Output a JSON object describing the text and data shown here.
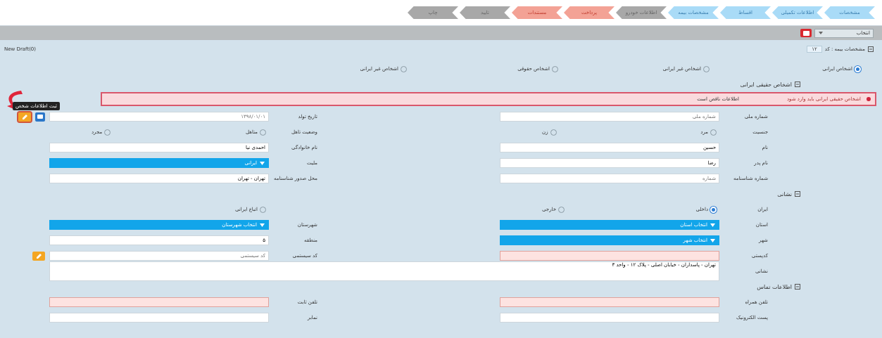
{
  "steps": [
    {
      "label": "مشخصات",
      "kind": "info"
    },
    {
      "label": "اطلاعات تکمیلی",
      "kind": "info"
    },
    {
      "label": "اقساط",
      "kind": "info"
    },
    {
      "label": "مشخصات بیمه",
      "kind": "info"
    },
    {
      "label": "اطلاعات خودرو",
      "kind": "pending"
    },
    {
      "label": "پرداخت",
      "kind": "error"
    },
    {
      "label": "مستندات",
      "kind": "error"
    },
    {
      "label": "تایید",
      "kind": "pending"
    },
    {
      "label": "چاپ",
      "kind": "pending"
    }
  ],
  "toolbar": {
    "select": {
      "value": "انتخاب"
    }
  },
  "header": {
    "title": "مشخصات بیمه : کد",
    "code": "۱۲",
    "draft": "New Draft(0)"
  },
  "person_types": [
    {
      "label": "اشخاص ایرانی",
      "selected": true
    },
    {
      "label": "اشخاص غیر ایرانی",
      "selected": false
    },
    {
      "label": "اشخاص حقوقی",
      "selected": false
    },
    {
      "label": "اشخاص غیر ایرانی",
      "selected": false
    }
  ],
  "sections": [
    {
      "title": "اشخاص حقیقی ایرانی",
      "error": {
        "title": "اشخاص حقیقی ایرانی باید وارد شود",
        "detail": "اطلاعات ناقص است"
      },
      "rows": [
        {
          "fields": [
            {
              "kind": "text",
              "label": "شماره ملی",
              "placeholder": "شماره ملی"
            },
            {
              "kind": "text",
              "label": "تاریخ تولد",
              "placeholder": "۱۳۹۸/۰۱/۰۱",
              "buttons": [
                {
                  "kind": "primary"
                },
                {
                  "kind": "warning",
                  "tooltip": "ثبت اطلاعات شخص"
                }
              ]
            }
          ]
        },
        {
          "fields": [
            {
              "kind": "radio",
              "label": "جنسیت",
              "options": [
                {
                  "label": "مرد",
                  "selected": false
                },
                {
                  "label": "زن",
                  "selected": false
                }
              ]
            },
            {
              "kind": "radio",
              "label": "وضعیت تاهل",
              "options": [
                {
                  "label": "متاهل",
                  "selected": false
                },
                {
                  "label": "مجرد",
                  "selected": false
                }
              ]
            }
          ]
        },
        {
          "fields": [
            {
              "kind": "text",
              "label": "نام",
              "value": "حسین"
            },
            {
              "kind": "text",
              "label": "نام خانوادگی",
              "value": "احمدی نیا"
            }
          ]
        },
        {
          "fields": [
            {
              "kind": "text",
              "label": "نام پدر",
              "value": "رضا"
            },
            {
              "kind": "select",
              "label": "ملیت",
              "value": "ایرانی"
            }
          ]
        },
        {
          "fields": [
            {
              "kind": "text",
              "label": "شماره شناسنامه",
              "placeholder": "شماره"
            },
            {
              "kind": "text",
              "label": "محل صدور شناسنامه",
              "value": "تهران - تهران"
            }
          ]
        }
      ]
    },
    {
      "title": "نشانی",
      "rows": [
        {
          "fields": [
            {
              "kind": "radio",
              "label": "ایران",
              "options": [
                {
                  "label": "داخلی",
                  "selected": true
                },
                {
                  "label": "خارجی",
                  "selected": false
                }
              ]
            },
            {
              "kind": "radio",
              "options": [
                {
                  "label": "اتباع ایرانی",
                  "selected": false
                }
              ]
            }
          ]
        },
        {
          "fields": [
            {
              "kind": "select",
              "label": "استان",
              "value": "انتخاب استان"
            },
            {
              "kind": "select",
              "label": "شهرستان",
              "value": "انتخاب شهرستان"
            }
          ]
        },
        {
          "fields": [
            {
              "kind": "select",
              "label": "شهر",
              "value": "انتخاب شهر"
            },
            {
              "kind": "text",
              "label": "منطقه",
              "value": "۵"
            }
          ]
        },
        {
          "fields": [
            {
              "kind": "text",
              "label": "کدپستی",
              "invalid": true
            },
            {
              "kind": "text",
              "label": "کد سیستمی",
              "placeholder": "کد سیستمی",
              "buttons": [
                {
                  "kind": "warning"
                }
              ]
            }
          ]
        },
        {
          "fields": [
            {
              "kind": "textarea",
              "label": "نشانی",
              "value": "تهران - پاسداران - خیابان اصلی - پلاک ۱۲ - واحد ۳"
            }
          ]
        }
      ]
    },
    {
      "title": "اطلاعات تماس",
      "rows": [
        {
          "fields": [
            {
              "kind": "text",
              "label": "تلفن همراه",
              "invalid": true
            },
            {
              "kind": "text",
              "label": "تلفن ثابت",
              "invalid": true
            }
          ]
        },
        {
          "fields": [
            {
              "kind": "text",
              "label": "پست الکترونیک"
            },
            {
              "kind": "text",
              "label": "نمابر"
            }
          ]
        }
      ]
    }
  ]
}
